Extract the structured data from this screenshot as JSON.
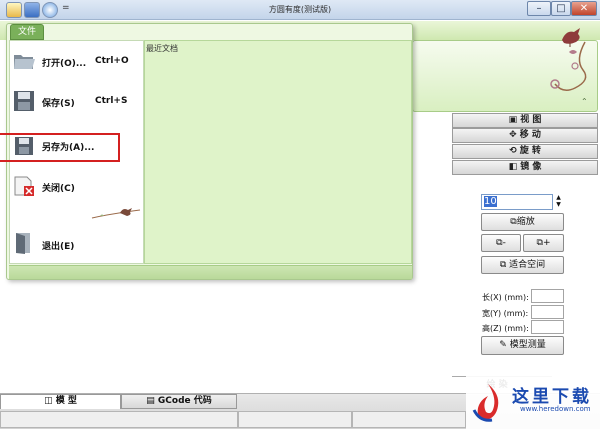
{
  "window": {
    "title": "方圆有度(测试版)",
    "min_label": "–",
    "max_label": "□",
    "close_label": "✕",
    "qa_more": "="
  },
  "file_menu": {
    "tab_label": "文件",
    "recent_title": "最近文档",
    "items": [
      {
        "label": "打开(O)...",
        "shortcut": "Ctrl+O",
        "icon": "folder-open-icon"
      },
      {
        "label": "保存(S)",
        "shortcut": "Ctrl+S",
        "icon": "floppy-disk-icon"
      },
      {
        "label": "另存为(A)...",
        "shortcut": "",
        "icon": "save-as-icon"
      },
      {
        "label": "关闭(C)",
        "shortcut": "",
        "icon": "close-document-icon"
      },
      {
        "label": "退出(E)",
        "shortcut": "",
        "icon": "exit-door-icon"
      }
    ]
  },
  "right_panel": {
    "tabs": [
      {
        "label": "视 图",
        "icon": "view-cube-icon"
      },
      {
        "label": "移 动",
        "icon": "move-arrows-icon"
      },
      {
        "label": "旋 转",
        "icon": "rotate-icon"
      },
      {
        "label": "镜 像",
        "icon": "mirror-icon"
      }
    ],
    "scale_value": "10",
    "scale_button": "缩放",
    "minus_button": "-",
    "plus_button": "+",
    "fit_button": "适合空间",
    "dims": [
      {
        "label": "长(X) (mm):"
      },
      {
        "label": "宽(Y) (mm):"
      },
      {
        "label": "高(Z) (mm):"
      }
    ],
    "measure_button": "模型测量",
    "partial_tab": "绘 染"
  },
  "bottom_tabs": [
    {
      "label": "模 型",
      "icon": "model-cube-icon"
    },
    {
      "label": "GCode 代码",
      "icon": "document-icon"
    }
  ],
  "watermark": {
    "text": "这里下载",
    "url": "www.heredown.com"
  }
}
